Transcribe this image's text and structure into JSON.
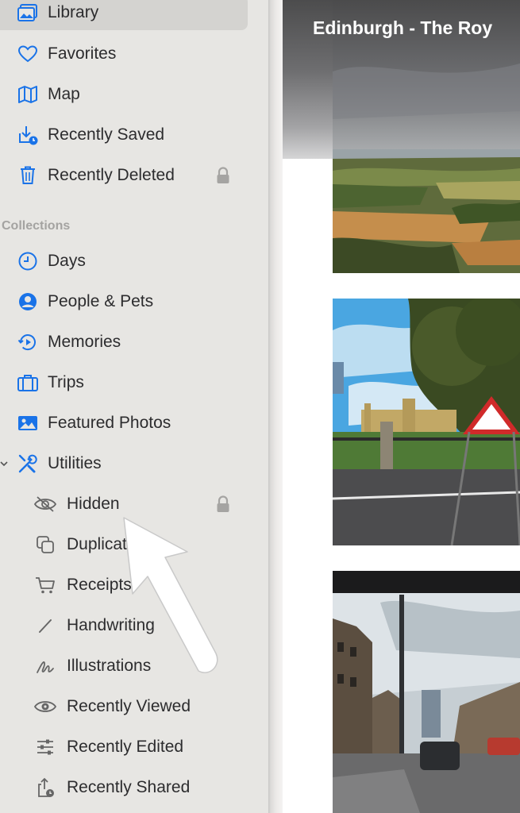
{
  "sidebar": {
    "library_items": [
      {
        "label": "Library",
        "icon": "photo-library-icon",
        "selected": true
      },
      {
        "label": "Favorites",
        "icon": "heart-icon"
      },
      {
        "label": "Map",
        "icon": "map-icon"
      },
      {
        "label": "Recently Saved",
        "icon": "recently-saved-icon"
      },
      {
        "label": "Recently Deleted",
        "icon": "trash-icon",
        "locked": true
      }
    ],
    "collections_header": "Collections",
    "collections": [
      {
        "label": "Days",
        "icon": "clock-icon"
      },
      {
        "label": "People & Pets",
        "icon": "person-icon"
      },
      {
        "label": "Memories",
        "icon": "memories-icon"
      },
      {
        "label": "Trips",
        "icon": "suitcase-icon"
      },
      {
        "label": "Featured Photos",
        "icon": "featured-photo-icon"
      },
      {
        "label": "Utilities",
        "icon": "tools-icon",
        "expanded": true
      }
    ],
    "utilities": [
      {
        "label": "Hidden",
        "icon": "eye-slash-icon",
        "locked": true
      },
      {
        "label": "Duplicates",
        "icon": "duplicate-icon"
      },
      {
        "label": "Receipts",
        "icon": "cart-icon"
      },
      {
        "label": "Handwriting",
        "icon": "pencil-icon"
      },
      {
        "label": "Illustrations",
        "icon": "scribble-icon"
      },
      {
        "label": "Recently Viewed",
        "icon": "eye-icon"
      },
      {
        "label": "Recently Edited",
        "icon": "sliders-icon"
      },
      {
        "label": "Recently Shared",
        "icon": "share-icon"
      }
    ]
  },
  "content": {
    "header_title": "Edinburgh - The Roy"
  },
  "colors": {
    "accent": "#1a73e8",
    "sidebar_bg": "#e7e6e3",
    "selected_bg": "#d4d3d0"
  }
}
